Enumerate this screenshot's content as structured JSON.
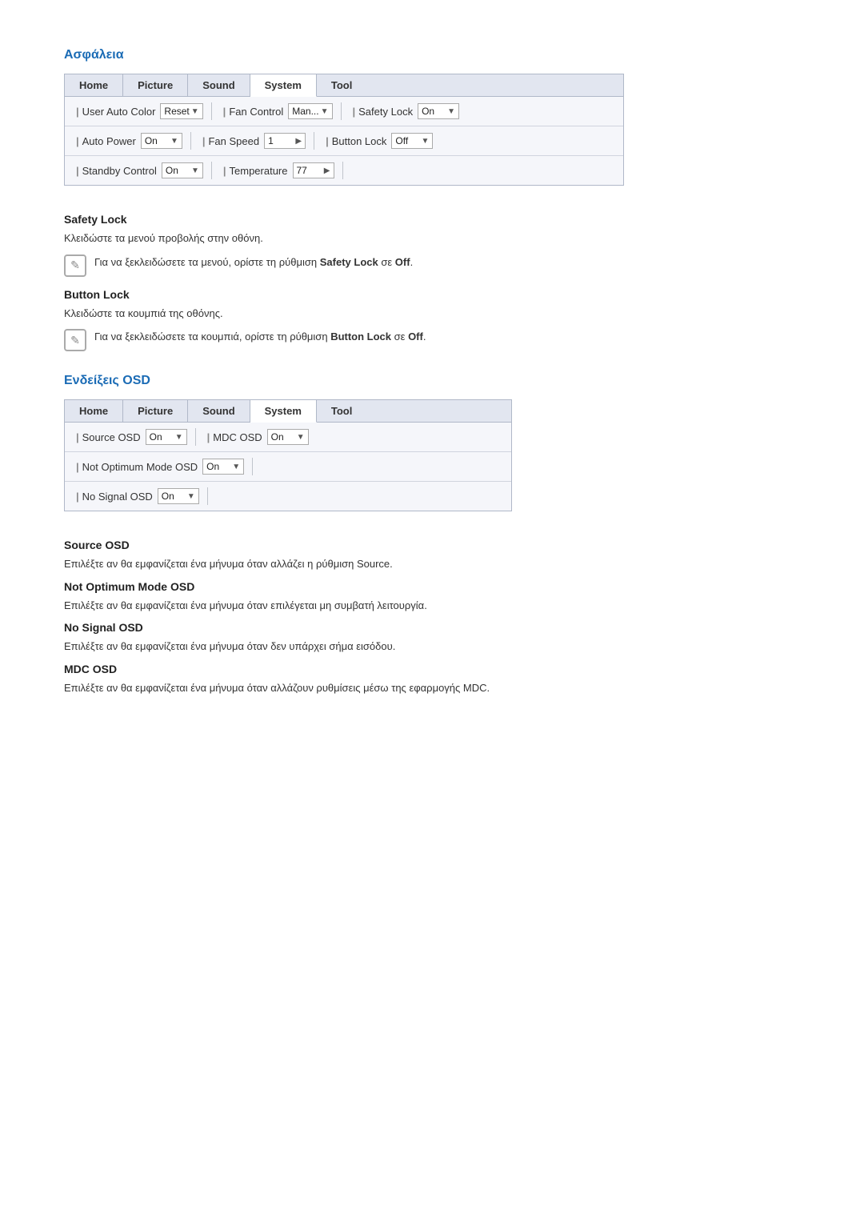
{
  "sections": [
    {
      "id": "asfaleia",
      "title": "Ασφάλεια",
      "tabs": [
        "Home",
        "Picture",
        "Sound",
        "System",
        "Tool"
      ],
      "activeTab": "System",
      "rows": [
        {
          "columns": [
            {
              "label": "User Auto Color",
              "control": "Reset",
              "controlType": "select"
            },
            {
              "label": "Fan Control",
              "control": "Man...",
              "controlType": "select"
            },
            {
              "label": "Safety Lock",
              "control": "On",
              "controlType": "select"
            }
          ]
        },
        {
          "columns": [
            {
              "label": "Auto Power",
              "control": "On",
              "controlType": "select"
            },
            {
              "label": "Fan Speed",
              "control": "1",
              "controlType": "arrow"
            },
            {
              "label": "Button Lock",
              "control": "Off",
              "controlType": "select"
            }
          ]
        },
        {
          "columns": [
            {
              "label": "Standby Control",
              "control": "On",
              "controlType": "select"
            },
            {
              "label": "Temperature",
              "control": "77",
              "controlType": "arrow"
            },
            {
              "label": "",
              "control": "",
              "controlType": "none"
            }
          ]
        }
      ],
      "subsections": [
        {
          "id": "safety-lock",
          "title": "Safety Lock",
          "description": "Κλειδώστε τα μενού προβολής στην οθόνη.",
          "note": "Για να ξεκλειδώσετε τα μενού, ορίστε τη ρύθμιση Safety Lock σε Off.",
          "noteBold": [
            "Safety Lock",
            "Off"
          ]
        },
        {
          "id": "button-lock",
          "title": "Button Lock",
          "description": "Κλειδώστε τα κουμπιά της οθόνης.",
          "note": "Για να ξεκλειδώσετε τα κουμπιά, ορίστε τη ρύθμιση Button Lock σε Off.",
          "noteBold": [
            "Button Lock",
            "Off"
          ]
        }
      ]
    },
    {
      "id": "endeixeis-osd",
      "title": "Ενδείξεις OSD",
      "tabs": [
        "Home",
        "Picture",
        "Sound",
        "System",
        "Tool"
      ],
      "activeTab": "System",
      "rows": [
        {
          "columns": [
            {
              "label": "Source OSD",
              "control": "On",
              "controlType": "select"
            },
            {
              "label": "MDC OSD",
              "control": "On",
              "controlType": "select"
            },
            {
              "label": "",
              "control": "",
              "controlType": "none"
            }
          ]
        },
        {
          "columns": [
            {
              "label": "Not Optimum Mode OSD",
              "control": "On",
              "controlType": "select"
            },
            {
              "label": "",
              "control": "",
              "controlType": "none"
            },
            {
              "label": "",
              "control": "",
              "controlType": "none"
            }
          ]
        },
        {
          "columns": [
            {
              "label": "No Signal OSD",
              "control": "On",
              "controlType": "select"
            },
            {
              "label": "",
              "control": "",
              "controlType": "none"
            },
            {
              "label": "",
              "control": "",
              "controlType": "none"
            }
          ]
        }
      ],
      "subsections": [
        {
          "id": "source-osd",
          "title": "Source OSD",
          "description": "Επιλέξτε αν θα εμφανίζεται ένα μήνυμα όταν αλλάζει η ρύθμιση Source.",
          "note": null
        },
        {
          "id": "not-optimum-mode-osd",
          "title": "Not Optimum Mode OSD",
          "description": "Επιλέξτε αν θα εμφανίζεται ένα μήνυμα όταν επιλέγεται μη συμβατή λειτουργία.",
          "note": null
        },
        {
          "id": "no-signal-osd",
          "title": "No Signal OSD",
          "description": "Επιλέξτε αν θα εμφανίζεται ένα μήνυμα όταν δεν υπάρχει σήμα εισόδου.",
          "note": null
        },
        {
          "id": "mdc-osd",
          "title": "MDC OSD",
          "description": "Επιλέξτε αν θα εμφανίζεται ένα μήνυμα όταν αλλάζουν ρυθμίσεις μέσω της εφαρμογής MDC.",
          "note": null
        }
      ]
    }
  ],
  "icons": {
    "pencil": "✎",
    "arrow_right": "▶",
    "dropdown": "▼"
  }
}
